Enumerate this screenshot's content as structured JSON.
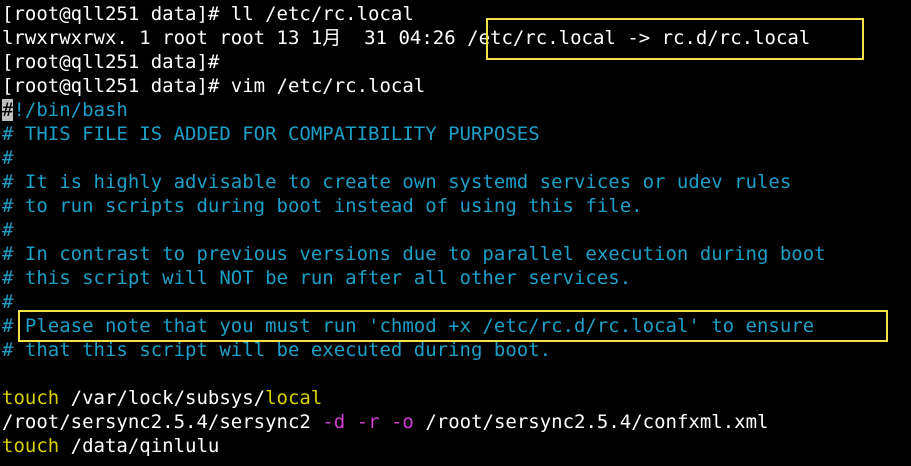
{
  "colors": {
    "background": "#000000",
    "text": "#ffffff",
    "comment": "#1d9fc7",
    "keyword": "#d8d000",
    "option": "#d43fd1",
    "highlight_box": "#f4e24a"
  },
  "shell": {
    "line1": "[root@qll251 data]# ll /etc/rc.local",
    "line2_prefix": "lrwxrwxrwx. 1 root root 13 1月  31 04:26 ",
    "line2_link": "/etc/rc.local",
    "line2_arrow": " -> rc.d/rc.local",
    "line3": "[root@qll251 data]#",
    "line4": "[root@qll251 data]# vim /etc/rc.local"
  },
  "file": {
    "shebang_cursor": "#",
    "shebang_rest": "!/bin/bash",
    "comments": [
      "# THIS FILE IS ADDED FOR COMPATIBILITY PURPOSES",
      "#",
      "# It is highly advisable to create own systemd services or udev rules",
      "# to run scripts during boot instead of using this file.",
      "#",
      "# In contrast to previous versions due to parallel execution during boot",
      "# this script will NOT be run after all other services.",
      "#",
      "# Please note that you must run 'chmod +x /etc/rc.d/rc.local' to ensure",
      "# that this script will be executed during boot."
    ],
    "cmd1": {
      "kw": "touch",
      "path": " /var/lock/subsys/",
      "tail": "local"
    },
    "cmd2": {
      "path": "/root/sersync2.5.4/sersync2 ",
      "opt_d": "-d",
      "opt_r": "-r",
      "opt_o": "-o",
      "arg": " /root/sersync2.5.4/confxml.xml"
    },
    "cmd3": {
      "kw": "touch",
      "path": " /data/qinlulu"
    }
  }
}
